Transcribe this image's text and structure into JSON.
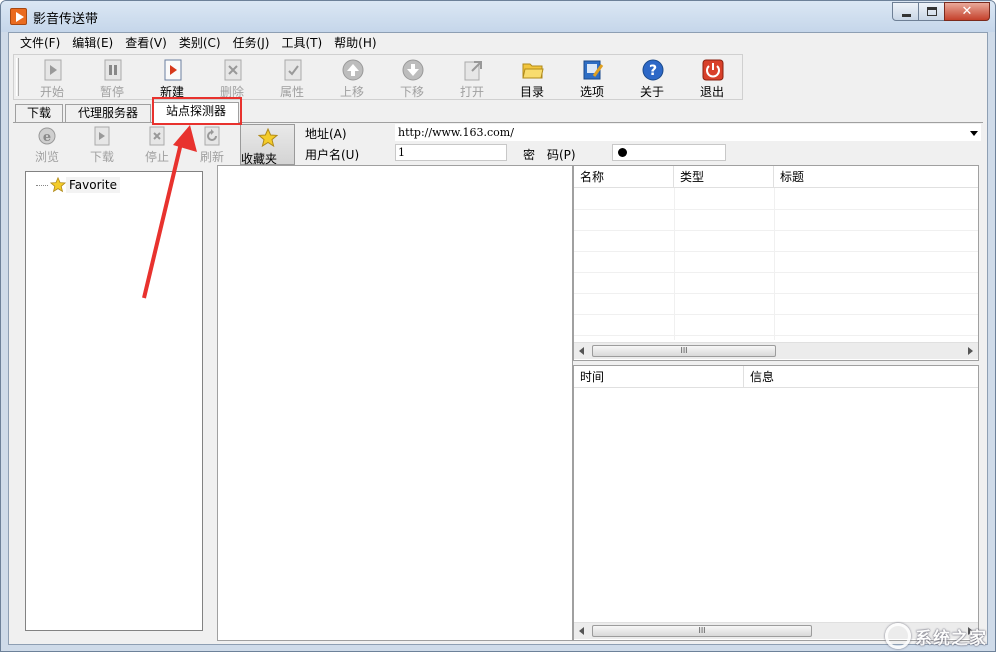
{
  "window": {
    "title": "影音传送带",
    "close_glyph": "✕"
  },
  "menu": [
    "文件(F)",
    "编辑(E)",
    "查看(V)",
    "类别(C)",
    "任务(J)",
    "工具(T)",
    "帮助(H)"
  ],
  "toolbar": [
    {
      "label": "开始",
      "icon": "play-icon",
      "enabled": false
    },
    {
      "label": "暂停",
      "icon": "pause-icon",
      "enabled": false
    },
    {
      "label": "新建",
      "icon": "new-icon",
      "enabled": true
    },
    {
      "label": "删除",
      "icon": "delete-icon",
      "enabled": false
    },
    {
      "label": "属性",
      "icon": "properties-icon",
      "enabled": false
    },
    {
      "label": "上移",
      "icon": "move-up-icon",
      "enabled": false
    },
    {
      "label": "下移",
      "icon": "move-down-icon",
      "enabled": false
    },
    {
      "label": "打开",
      "icon": "open-icon",
      "enabled": false
    },
    {
      "label": "目录",
      "icon": "folder-icon",
      "enabled": true
    },
    {
      "label": "选项",
      "icon": "options-icon",
      "enabled": true
    },
    {
      "label": "关于",
      "icon": "help-icon",
      "enabled": true
    },
    {
      "label": "退出",
      "icon": "power-icon",
      "enabled": true
    }
  ],
  "tabs": [
    {
      "label": "下载",
      "active": false
    },
    {
      "label": "代理服务器",
      "active": false
    },
    {
      "label": "站点探测器",
      "active": true
    }
  ],
  "explorer_toolbar": [
    {
      "label": "浏览",
      "icon": "browse-icon",
      "enabled": false
    },
    {
      "label": "下载",
      "icon": "download-icon",
      "enabled": false
    },
    {
      "label": "停止",
      "icon": "stop-icon",
      "enabled": false
    },
    {
      "label": "刷新",
      "icon": "refresh-icon",
      "enabled": false
    }
  ],
  "favorites_button": {
    "label": "收藏夹",
    "icon": "star-icon"
  },
  "form": {
    "address_label": "地址(A)",
    "address_value": "http://www.163.com/",
    "username_label": "用户名(U)",
    "username_value": "1",
    "password_label": "密　码(P)"
  },
  "tree": {
    "items": [
      {
        "label": "Favorite",
        "icon": "star-icon"
      }
    ]
  },
  "file_list": {
    "columns": [
      "名称",
      "类型",
      "标题"
    ]
  },
  "log_list": {
    "columns": [
      "时间",
      "信息"
    ]
  },
  "scroll_thumb_glyph": "III",
  "watermark": "系统之家",
  "colors": {
    "accent_red": "#e8322e",
    "title_bar": "#c5d6ea"
  }
}
